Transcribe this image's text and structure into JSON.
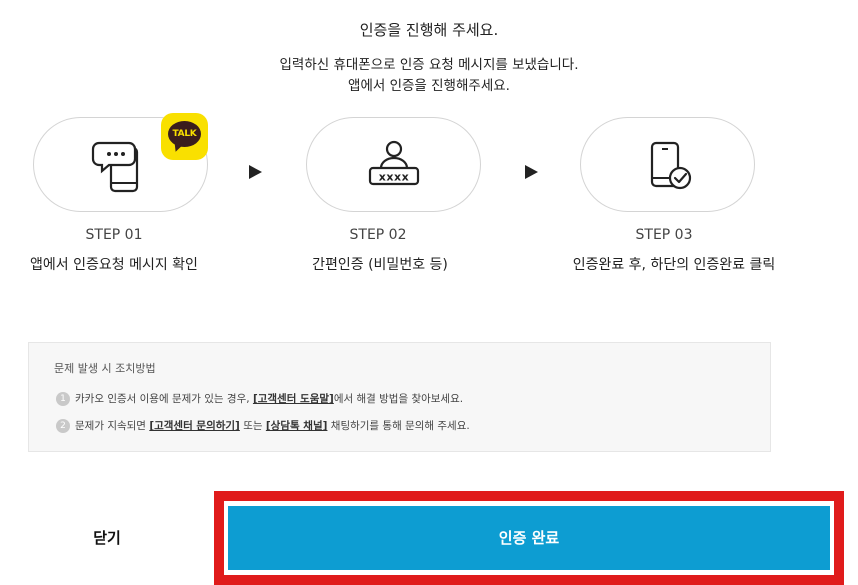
{
  "header": {
    "title": "인증을 진행해 주세요.",
    "line1": "입력하신 휴대폰으로 인증 요청 메시지를 보냈습니다.",
    "line2": "앱에서 인증을 진행해주세요."
  },
  "steps": [
    {
      "number": "STEP 01",
      "desc": "앱에서 인증요청 메시지 확인",
      "icon": "phone-message-icon",
      "badge": "TALK"
    },
    {
      "number": "STEP 02",
      "desc": "간편인증 (비밀번호 등)",
      "icon": "user-password-icon",
      "password_mask": "xxxx"
    },
    {
      "number": "STEP 03",
      "desc": "인증완료 후, 하단의 인증완료 클릭",
      "icon": "phone-check-icon"
    }
  ],
  "help": {
    "title": "문제 발생 시 조치방법",
    "items": [
      {
        "num": "1",
        "before": "카카오 인증서 이용에 문제가 있는 경우,",
        "link1": "[고객센터 도움말]",
        "after": "에서 해결 방법을 찾아보세요."
      },
      {
        "num": "2",
        "before": "문제가 지속되면",
        "link1": "[고객센터 문의하기]",
        "mid": "또는",
        "link2": "[상담톡 채널]",
        "after": "채팅하기를 통해 문의해 주세요."
      }
    ]
  },
  "footer": {
    "close_label": "닫기",
    "confirm_label": "인증 완료"
  },
  "colors": {
    "accent": "#0d9dd2",
    "highlight_border": "#e01b1b",
    "kakao_yellow": "#f9e000"
  }
}
